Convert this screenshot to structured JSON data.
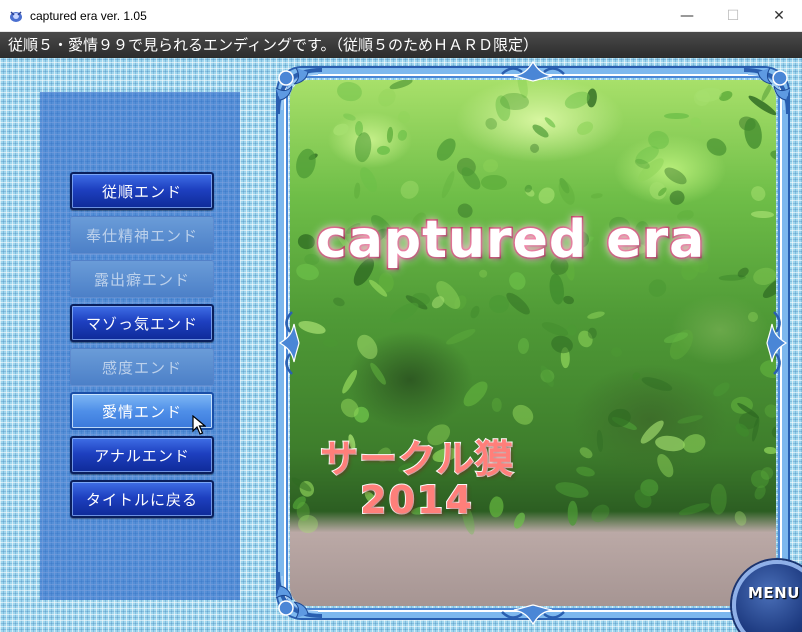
{
  "window": {
    "title": "captured era ver. 1.05",
    "minimize_glyph": "—",
    "maximize_glyph": "☐",
    "close_glyph": "✕"
  },
  "message": "従順５・愛情９９で見られるエンディングです。（従順５のためＨＡＲＤ限定）",
  "menu": {
    "items": [
      {
        "label": "従順エンド",
        "state": "enabled"
      },
      {
        "label": "奉仕精神エンド",
        "state": "disabled"
      },
      {
        "label": "露出癖エンド",
        "state": "disabled"
      },
      {
        "label": "マゾっ気エンド",
        "state": "enabled"
      },
      {
        "label": "感度エンド",
        "state": "disabled"
      },
      {
        "label": "愛情エンド",
        "state": "hover"
      },
      {
        "label": "アナルエンド",
        "state": "enabled"
      },
      {
        "label": "タイトルに戻る",
        "state": "enabled"
      }
    ]
  },
  "art": {
    "game_title": "captured era",
    "circle_name": "サークル獏",
    "year": "2014"
  },
  "corner_menu_label": "MENU",
  "colors": {
    "button_enabled": "#1e40c0",
    "button_disabled": "#5a8cd0",
    "button_hover": "#4f8fe8",
    "panel": "#2864c8",
    "title_stroke": "#a3123c",
    "circle_text": "#ff7f7a"
  },
  "icons": {
    "app": "captured-era-app-icon",
    "cursor": "arrow-cursor-icon"
  }
}
